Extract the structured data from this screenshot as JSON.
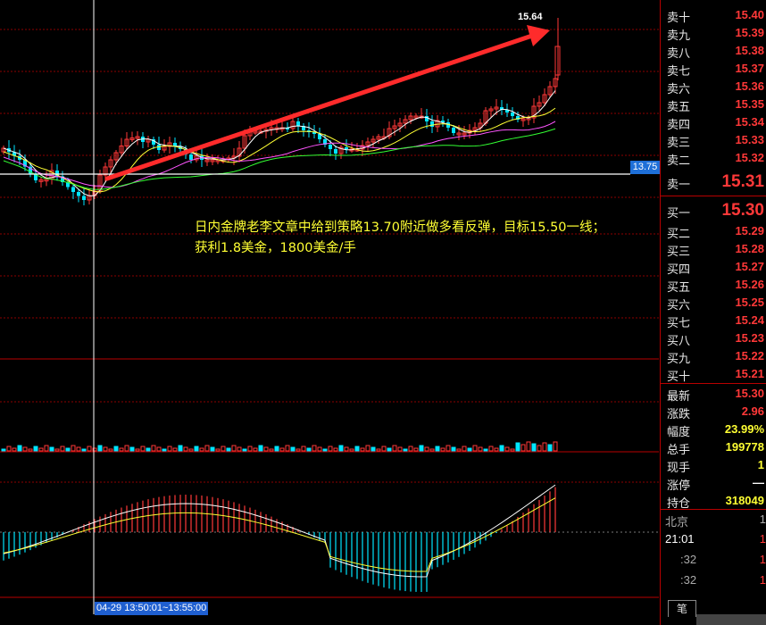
{
  "chart": {
    "top_label": "15.64",
    "last_price_tag": "13.75",
    "time_label": "04-29 13:50:01~13:55:00",
    "annotation_line1": "日内金牌老李文章中给到策略13.70附近做多看反弹，目标15.50一线；",
    "annotation_line2": "获利1.8美金，1800美金/手"
  },
  "quotes": {
    "asks": [
      {
        "label": "卖十",
        "price": "15.40"
      },
      {
        "label": "卖九",
        "price": "15.39"
      },
      {
        "label": "卖八",
        "price": "15.38"
      },
      {
        "label": "卖七",
        "price": "15.37"
      },
      {
        "label": "卖六",
        "price": "15.36"
      },
      {
        "label": "卖五",
        "price": "15.35"
      },
      {
        "label": "卖四",
        "price": "15.34"
      },
      {
        "label": "卖三",
        "price": "15.33"
      },
      {
        "label": "卖二",
        "price": "15.32"
      },
      {
        "label": "卖一",
        "price": "15.31"
      }
    ],
    "bids": [
      {
        "label": "买一",
        "price": "15.30"
      },
      {
        "label": "买二",
        "price": "15.29"
      },
      {
        "label": "买三",
        "price": "15.28"
      },
      {
        "label": "买四",
        "price": "15.27"
      },
      {
        "label": "买五",
        "price": "15.26"
      },
      {
        "label": "买六",
        "price": "15.25"
      },
      {
        "label": "买七",
        "price": "15.24"
      },
      {
        "label": "买八",
        "price": "15.23"
      },
      {
        "label": "买九",
        "price": "15.22"
      },
      {
        "label": "买十",
        "price": "15.21"
      }
    ],
    "stats": [
      {
        "label": "最新",
        "value": "15.30"
      },
      {
        "label": "涨跌",
        "value": "2.96"
      },
      {
        "label": "幅度",
        "value": "23.99%"
      },
      {
        "label": "总手",
        "value": "199778"
      },
      {
        "label": "现手",
        "value": "1"
      },
      {
        "label": "涨停",
        "value": "—"
      },
      {
        "label": "持仓",
        "value": "318049"
      }
    ],
    "ticks": {
      "location": "北京",
      "time": "21:01",
      "time_right": "1",
      "row1_left": ":32",
      "row1_right": "1",
      "row2_left": ":32",
      "row2_right": "1"
    },
    "tab_label": "笔"
  },
  "colors": {
    "up": "#ff3838",
    "down": "#00e5ff",
    "grid": "#8b0000",
    "accent_blue": "#1e6fd8"
  }
}
